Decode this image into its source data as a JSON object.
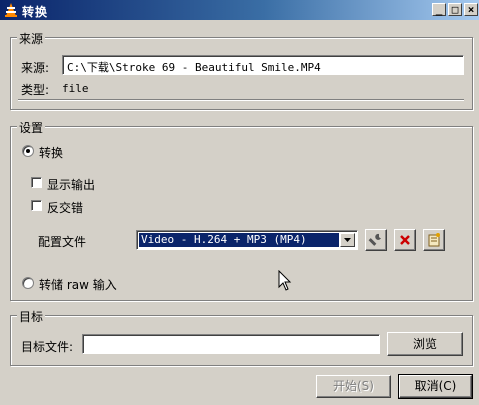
{
  "window": {
    "title": "转换",
    "minimize_glyph": "_",
    "maximize_glyph": "□",
    "close_glyph": "×"
  },
  "source": {
    "group_label": "来源",
    "source_label": "来源:",
    "source_value": "C:\\下载\\Stroke 69 - Beautiful Smile.MP4",
    "type_label": "类型:",
    "type_value": "file"
  },
  "settings": {
    "group_label": "设置",
    "convert_label": "转换",
    "convert_selected": true,
    "show_output_label": "显示输出",
    "deinterlace_label": "反交错",
    "profile_label": "配置文件",
    "profile_value": "Video - H.264 + MP3 (MP4)",
    "dump_raw_label": "转储 raw 输入",
    "profile_tool_icons": [
      "wrench-icon",
      "delete-icon",
      "new-profile-icon"
    ],
    "delete_color": "#cc0000"
  },
  "destination": {
    "group_label": "目标",
    "file_label": "目标文件:",
    "file_value": "",
    "browse_label": "浏览"
  },
  "footer": {
    "start_label": "开始(S)",
    "cancel_label": "取消(C)"
  }
}
